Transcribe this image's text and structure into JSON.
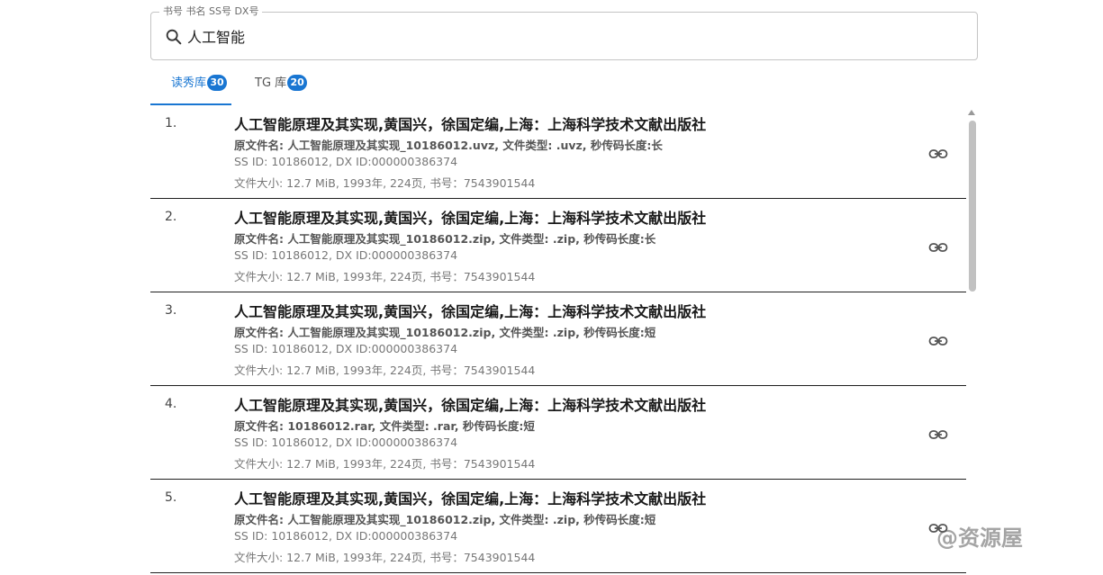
{
  "search": {
    "label": "书号 书名 SS号 DX号",
    "value": "人工智能"
  },
  "tabs": [
    {
      "label": "读秀库",
      "count": "30",
      "active": true
    },
    {
      "label": "TG 库",
      "count": "20",
      "active": false
    }
  ],
  "results": [
    {
      "index": "1.",
      "title": "人工智能原理及其实现,黄国兴，徐国定编,上海：上海科学技术文献出版社",
      "file": "原文件名: 人工智能原理及其实现_10186012.uvz, 文件类型: .uvz, 秒传码长度:长",
      "ids": "SS ID: 10186012, DX ID:000000386374",
      "meta": "文件大小: 12.7 MiB, 1993年, 224页, 书号：7543901544"
    },
    {
      "index": "2.",
      "title": "人工智能原理及其实现,黄国兴，徐国定编,上海：上海科学技术文献出版社",
      "file": "原文件名: 人工智能原理及其实现_10186012.zip, 文件类型: .zip, 秒传码长度:长",
      "ids": "SS ID: 10186012, DX ID:000000386374",
      "meta": "文件大小: 12.7 MiB, 1993年, 224页, 书号：7543901544"
    },
    {
      "index": "3.",
      "title": "人工智能原理及其实现,黄国兴，徐国定编,上海：上海科学技术文献出版社",
      "file": "原文件名: 人工智能原理及其实现_10186012.zip, 文件类型: .zip, 秒传码长度:短",
      "ids": "SS ID: 10186012, DX ID:000000386374",
      "meta": "文件大小: 12.7 MiB, 1993年, 224页, 书号：7543901544"
    },
    {
      "index": "4.",
      "title": "人工智能原理及其实现,黄国兴，徐国定编,上海：上海科学技术文献出版社",
      "file": "原文件名: 10186012.rar, 文件类型: .rar, 秒传码长度:短",
      "ids": "SS ID: 10186012, DX ID:000000386374",
      "meta": "文件大小: 12.7 MiB, 1993年, 224页, 书号：7543901544"
    },
    {
      "index": "5.",
      "title": "人工智能原理及其实现,黄国兴，徐国定编,上海：上海科学技术文献出版社",
      "file": "原文件名: 人工智能原理及其实现_10186012.zip, 文件类型: .zip, 秒传码长度:短",
      "ids": "SS ID: 10186012, DX ID:000000386374",
      "meta": "文件大小: 12.7 MiB, 1993年, 224页, 书号：7543901544"
    }
  ],
  "icons": {
    "search": "search-icon",
    "link": "link-icon"
  },
  "colors": {
    "accent": "#1976d2",
    "divider": "#1f1f1f"
  },
  "watermark": "@资源屋"
}
